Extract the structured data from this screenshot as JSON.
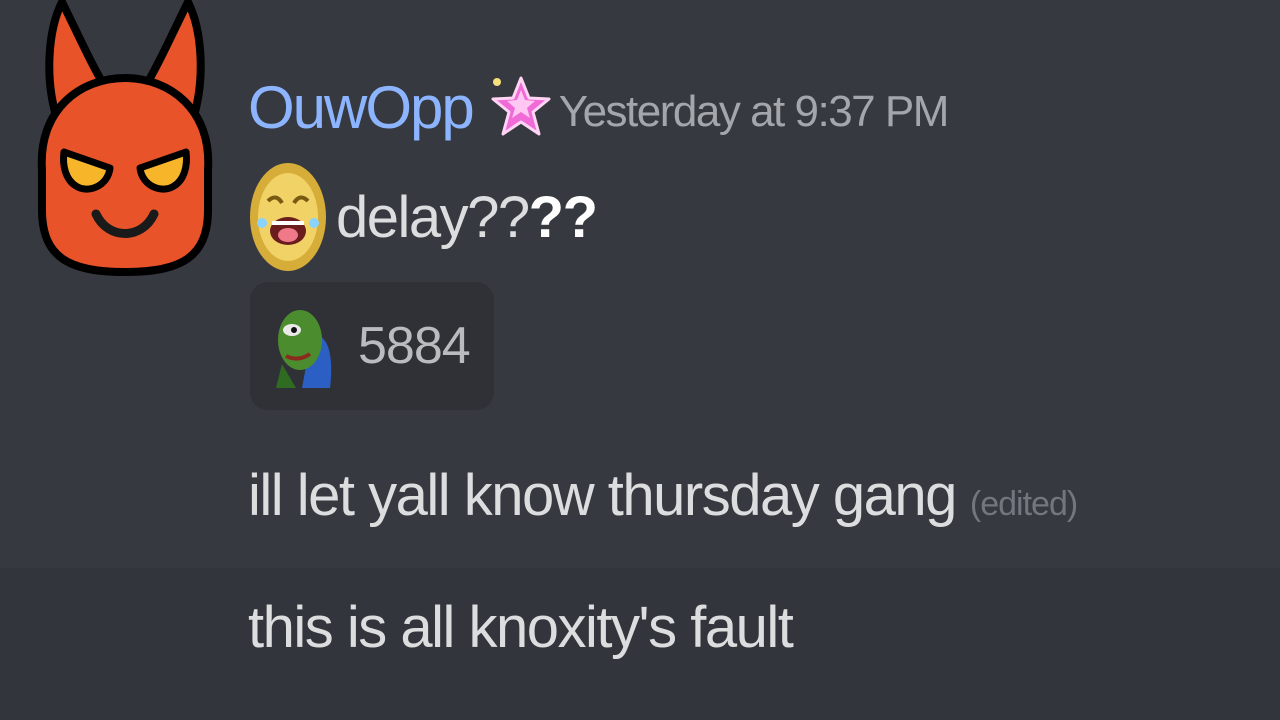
{
  "message": {
    "author": {
      "username": "OuwOpp",
      "username_color": "#8cb4ff",
      "avatar_icon": "devil-face-icon",
      "badge_icon": "pink-star-icon"
    },
    "timestamp": "Yesterday at 9:37 PM",
    "lines": [
      {
        "emoji_icon": "laughing-coin-emoji-icon",
        "text_plain": "delay??",
        "text_bold": "??"
      },
      {
        "text": "ill let yall know thursday gang",
        "edited_label": "(edited)"
      },
      {
        "text": "this is all knoxity's fault"
      }
    ],
    "reaction": {
      "emoji_icon": "pepe-frog-emoji-icon",
      "count": "5884"
    }
  },
  "colors": {
    "background": "#36393f",
    "text": "#dcddde",
    "timestamp": "#a3a6aa",
    "reaction_bg": "#2f3136"
  }
}
